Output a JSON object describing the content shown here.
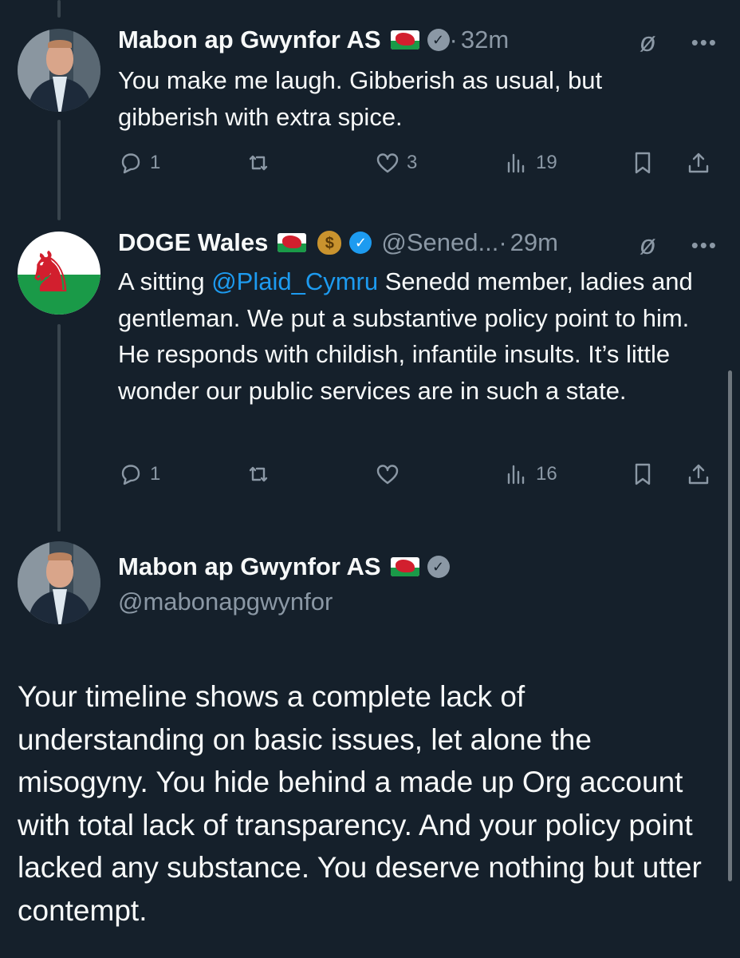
{
  "tweets": [
    {
      "author": "Mabon ap Gwynfor AS",
      "handle": "",
      "time": "32m",
      "text_parts": [
        "You make me laugh. Gibberish as usual, but gibberish with extra spice."
      ],
      "replies": "1",
      "reposts": "",
      "likes": "3",
      "views": "19"
    },
    {
      "author": "DOGE Wales",
      "handle": "@Sened...",
      "time": "29m",
      "text_before": "A sitting ",
      "mention": "@Plaid_Cymru",
      "text_after": " Senedd member, ladies and gentleman. We put a substantive policy point to him. He responds with childish, infantile insults. It’s little wonder our public services are in such a state.",
      "replies": "1",
      "reposts": "",
      "likes": "",
      "views": "16"
    }
  ],
  "focused_tweet": {
    "author": "Mabon ap Gwynfor AS",
    "handle": "@mabonapgwynfor",
    "text": "Your timeline shows a complete lack of understanding on basic issues, let alone the misogyny. You hide behind a made up Org account with total lack of transparency. And your policy point lacked any substance. You deserve nothing but utter contempt."
  },
  "icons": {
    "reply": "reply-icon",
    "repost": "repost-icon",
    "like": "heart-icon",
    "views": "views-icon",
    "bookmark": "bookmark-icon",
    "share": "share-icon",
    "grok": "grok-icon",
    "more": "more-icon"
  },
  "colors": {
    "background": "#15202b",
    "text": "#f7f9f9",
    "muted": "#8b98a5",
    "link": "#1d9bf0",
    "verified_blue": "#1d9bf0",
    "verified_grey": "#8b98a5"
  }
}
